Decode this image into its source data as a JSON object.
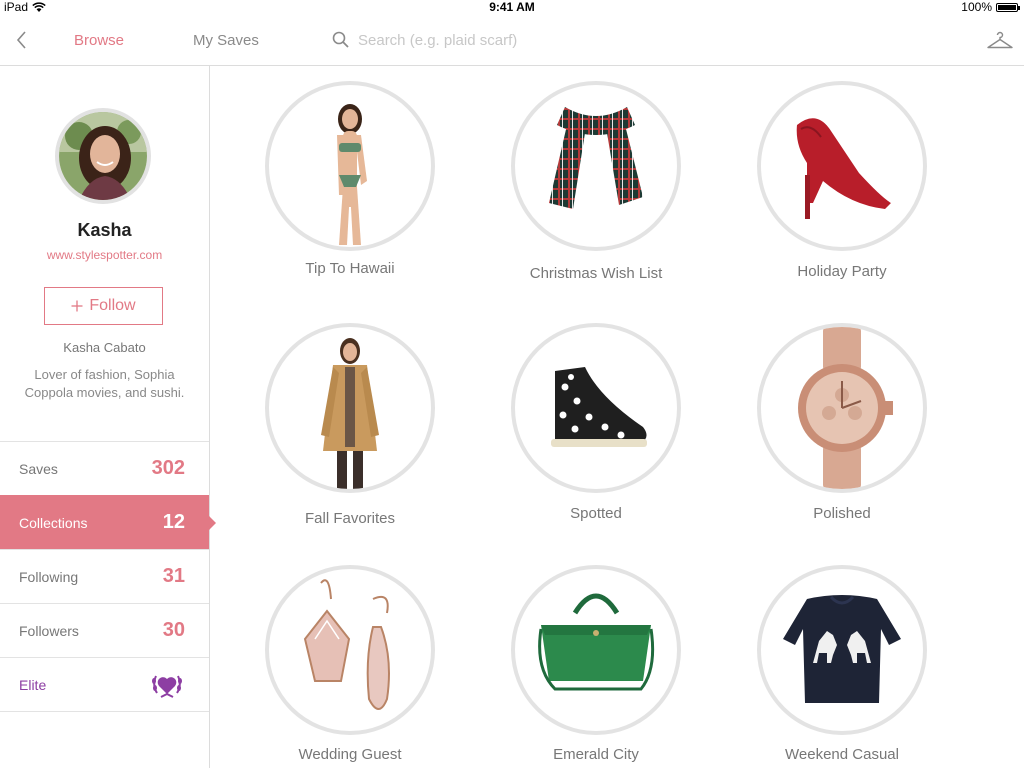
{
  "status_bar": {
    "carrier": "iPad",
    "time": "9:41 AM",
    "battery": "100%"
  },
  "nav": {
    "browse_label": "Browse",
    "my_saves_label": "My Saves",
    "search_placeholder": "Search (e.g. plaid scarf)"
  },
  "profile": {
    "name": "Kasha",
    "url": "www.stylespotter.com",
    "follow_label": "Follow",
    "full_name": "Kasha Cabato",
    "bio": "Lover of fashion, Sophia Coppola movies, and sushi."
  },
  "stats": [
    {
      "label": "Saves",
      "value": "302"
    },
    {
      "label": "Collections",
      "value": "12"
    },
    {
      "label": "Following",
      "value": "31"
    },
    {
      "label": "Followers",
      "value": "30"
    },
    {
      "label": "Elite",
      "value": ""
    }
  ],
  "collections": [
    {
      "title": "Tip To Hawaii"
    },
    {
      "title": "Christmas Wish List"
    },
    {
      "title": "Holiday Party"
    },
    {
      "title": "Fall Favorites"
    },
    {
      "title": "Spotted"
    },
    {
      "title": "Polished"
    },
    {
      "title": "Wedding Guest"
    },
    {
      "title": "Emerald City"
    },
    {
      "title": "Weekend Casual"
    }
  ],
  "colors": {
    "accent": "#e27985",
    "elite": "#8d3ea3",
    "border": "#e3e3e3"
  }
}
